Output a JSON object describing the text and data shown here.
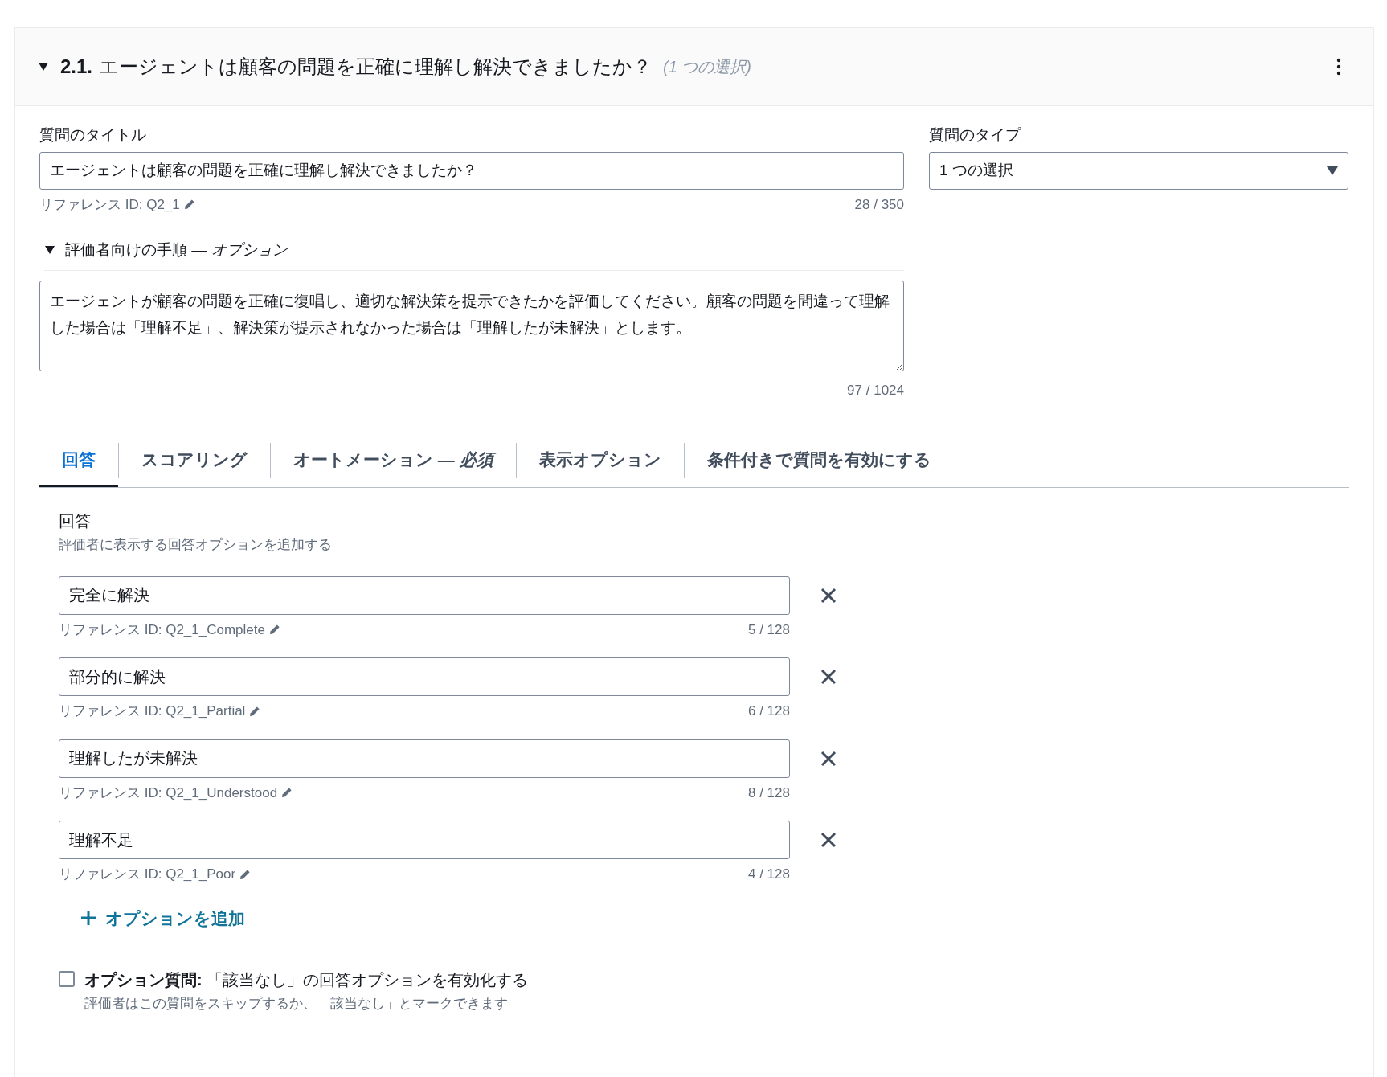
{
  "header": {
    "expanded": true,
    "number": "2.1.",
    "title": "エージェントは顧客の問題を正確に理解し解決できましたか？",
    "type_note": "(1 つの選択)"
  },
  "title_field": {
    "label": "質問のタイトル",
    "value": "エージェントは顧客の問題を正確に理解し解決できましたか？",
    "reference": "リファレンス ID: Q2_1",
    "counter": "28 / 350"
  },
  "type_field": {
    "label": "質問のタイプ",
    "value": "1 つの選択"
  },
  "instructions": {
    "expanded": true,
    "label": "評価者向けの手順 — *オプション*",
    "value": "エージェントが顧客の問題を正確に復唱し、適切な解決策を提示できたかを評価してください。顧客の問題を間違って理解した場合は「理解不足」、解決策が提示されなかった場合は「理解したが未解決」とします。",
    "counter": "97 / 1024"
  },
  "tabs": [
    {
      "label": "回答",
      "selected": true
    },
    {
      "label": "スコアリング",
      "selected": false
    },
    {
      "label": "オートメーション — *必須*",
      "selected": false
    },
    {
      "label": "表示オプション",
      "selected": false
    },
    {
      "label": "条件付きで質問を有効にする",
      "selected": false
    }
  ],
  "answers": {
    "label": "回答",
    "description": "評価者に表示する回答オプションを追加する",
    "options": [
      {
        "value": "完全に解決",
        "reference": "リファレンス ID: Q2_1_Complete",
        "counter": "5 / 128"
      },
      {
        "value": "部分的に解決",
        "reference": "リファレンス ID: Q2_1_Partial",
        "counter": "6 / 128"
      },
      {
        "value": "理解したが未解決",
        "reference": "リファレンス ID: Q2_1_Understood",
        "counter": "8 / 128"
      },
      {
        "value": "理解不足",
        "reference": "リファレンス ID: Q2_1_Poor",
        "counter": "4 / 128"
      }
    ],
    "add_button": "オプションを追加"
  },
  "optional": {
    "checked": false,
    "label": "**オプション質問:** 「該当なし」の回答オプションを有効化する",
    "description": "評価者はこの質問をスキップするか、「該当なし」とマークできます"
  }
}
